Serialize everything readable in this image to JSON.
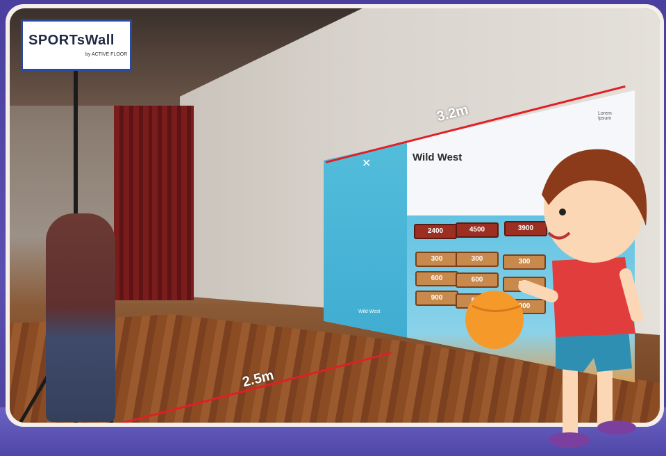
{
  "brand": {
    "name": "SPORTsWall",
    "subtitle": "by ACTIVE FLOOR"
  },
  "measurements": {
    "width_label": "3.2m",
    "distance_label": "2.5m"
  },
  "game_screen": {
    "title": "Wild West",
    "close_glyph": "✕",
    "sidebar_label": "Wild West",
    "user_label": "Lorem Ipsum",
    "scores": [
      "2400",
      "4500",
      "3900"
    ],
    "tiles": [
      [
        "300",
        "300",
        "300"
      ],
      [
        "600",
        "600",
        "900"
      ],
      [
        "900",
        "800",
        "900"
      ]
    ]
  },
  "colors": {
    "frame": "#f4efe8",
    "background": "#4a3f9e",
    "measure_line": "#e01f26",
    "screen_sidebar": "#3ba9cf"
  },
  "icons": {
    "close": "close-icon",
    "user": "user-icon",
    "ball": "ball-icon"
  }
}
